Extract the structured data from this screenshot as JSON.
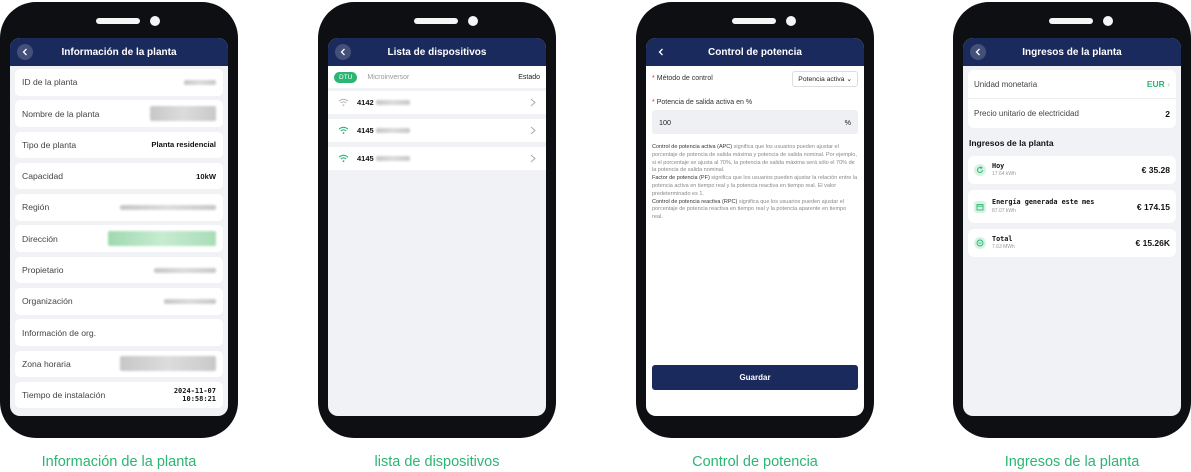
{
  "theme": {
    "accent": "#2bb673",
    "header": "#1b2a5c",
    "phone": "#0e0f12"
  },
  "screens": {
    "info": {
      "title": "Información de la planta",
      "caption": "Información de la planta",
      "rows": [
        {
          "label": "ID de la planta",
          "value": ""
        },
        {
          "label": "Nombre de la planta",
          "value": ""
        },
        {
          "label": "Tipo de planta",
          "value": "Planta residencial"
        },
        {
          "label": "Capacidad",
          "value": "10kW"
        },
        {
          "label": "Región",
          "value": ""
        },
        {
          "label": "Dirección",
          "value": ""
        },
        {
          "label": "Propietario",
          "value": ""
        },
        {
          "label": "Organización",
          "value": ""
        },
        {
          "label": "Información de org.",
          "value": ""
        },
        {
          "label": "Zona horaria",
          "value": ""
        },
        {
          "label": "Tiempo de instalación",
          "value": "2024-11-07",
          "value2": "10:58:21"
        }
      ]
    },
    "devices": {
      "title": "Lista de dispositivos",
      "caption": "lista de dispositivos",
      "tabs": {
        "active": "DTU",
        "other": "Microinversor",
        "state": "Estado"
      },
      "items": [
        {
          "id": "4142"
        },
        {
          "id": "4145"
        },
        {
          "id": "4145"
        }
      ]
    },
    "power": {
      "title": "Control de potencia",
      "caption": "Control de potencia",
      "method_label": "Método de control",
      "method_value": "Potencia activa",
      "output_label": "Potencia de salida activa en %",
      "output_value": "100",
      "output_unit": "%",
      "desc": {
        "apc_title": "Control de potencia activa (APC)",
        "apc_text": " significa que los usuarios pueden ajustar el porcentaje de potencia de salida máxima y potencia de salida nominal. Por ejemplo, si el porcentaje se ajusta al 70%, la potencia de salida máxima será sólo el 70% de la potencia de salida nominal.",
        "pf_title": "Factor de potencia (PF)",
        "pf_text": " significa que los usuarios pueden ajustar la relación entre la potencia activa en tiempo real y la potencia reactiva en tiempo real. El valor predeterminado es 1.",
        "rpc_title": "Control de potencia reactiva (RPC)",
        "rpc_text": " significa que los usuarios pueden ajustar el porcentaje de potencia reactiva en tiempo real y la potencia aparente en tiempo real."
      },
      "save_label": "Guardar"
    },
    "income": {
      "title": "Ingresos de la planta",
      "caption": "Ingresos de la planta",
      "currency_label": "Unidad monetaria",
      "currency_value": "EUR",
      "price_label": "Precio unitario de electricidad",
      "price_value": "2",
      "section_title": "Ingresos de la planta",
      "cards": [
        {
          "name": "Hoy",
          "sub": "17.64 kWh",
          "amount": "€ 35.28"
        },
        {
          "name": "Energía generada este mes",
          "sub": "87.07 kWh",
          "amount": "€ 174.15"
        },
        {
          "name": "Total",
          "sub": "7.63 MWh",
          "amount": "€ 15.26K"
        }
      ]
    }
  }
}
